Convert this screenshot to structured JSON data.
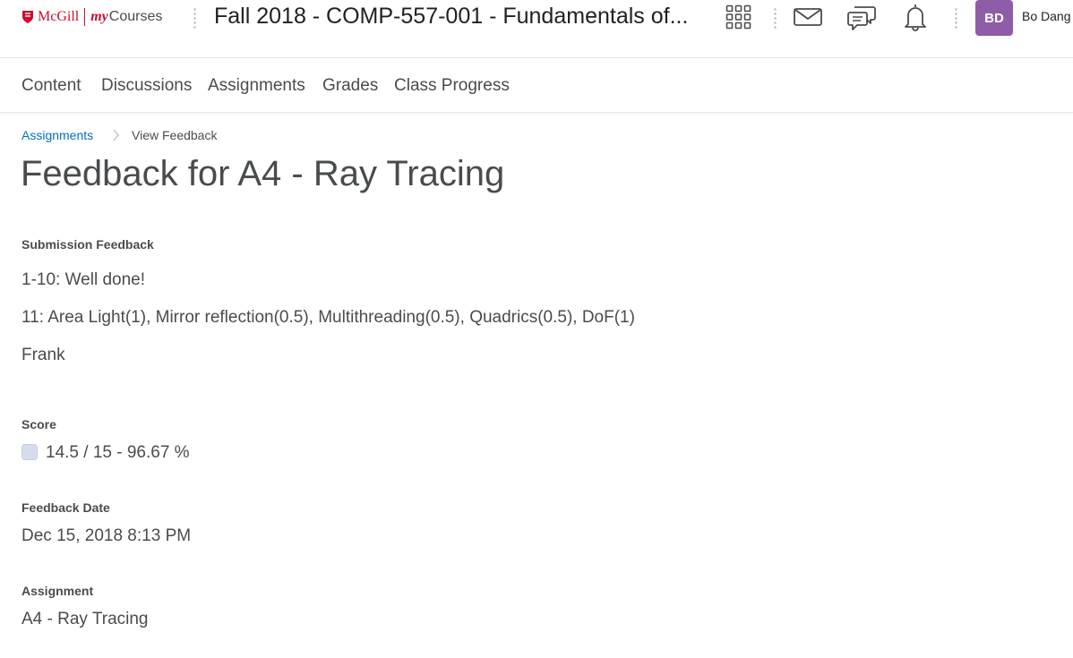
{
  "header": {
    "logo_mcgill": "McGill",
    "logo_my": "my",
    "logo_courses": "Courses",
    "course_title": "Fall 2018 - COMP-557-001 - Fundamentals of...",
    "user_initials": "BD",
    "user_name": "Bo Dang",
    "icons": [
      "course-selector-icon",
      "mail-icon",
      "chat-icon",
      "bell-icon"
    ],
    "avatar_color": "#8f5ca8",
    "brand_color": "#c8102e"
  },
  "nav": {
    "items": [
      "Content",
      "Discussions",
      "Assignments",
      "Grades",
      "Class Progress"
    ]
  },
  "breadcrumb": {
    "link": "Assignments",
    "current": "View Feedback",
    "link_color": "#006fbf"
  },
  "page": {
    "title": "Feedback for A4 - Ray Tracing",
    "submission_feedback_label": "Submission Feedback",
    "feedback_lines": [
      "1-10: Well done!",
      "11: Area Light(1), Mirror reflection(0.5), Multithreading(0.5), Quadrics(0.5), DoF(1)",
      "Frank"
    ],
    "score_label": "Score",
    "score_value": "14.5 / 15 - 96.67 %",
    "feedback_date_label": "Feedback Date",
    "feedback_date": "Dec 15, 2018 8:13 PM",
    "assignment_label": "Assignment",
    "assignment_value": "A4 - Ray Tracing"
  }
}
